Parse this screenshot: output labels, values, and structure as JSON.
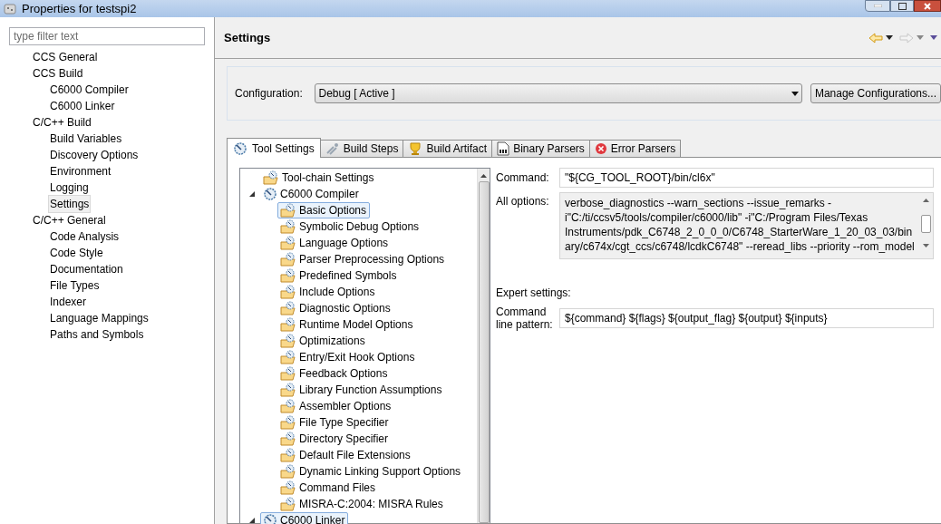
{
  "window": {
    "title": "Properties for testspi2"
  },
  "filter": {
    "placeholder": "type filter text"
  },
  "sidebar": {
    "items": [
      {
        "label": "CCS General",
        "selected": false
      },
      {
        "label": "CCS Build",
        "selected": false,
        "children": [
          {
            "label": "C6000 Compiler",
            "selected": false
          },
          {
            "label": "C6000 Linker",
            "selected": false
          }
        ]
      },
      {
        "label": "C/C++ Build",
        "selected": false,
        "children": [
          {
            "label": "Build Variables",
            "selected": false
          },
          {
            "label": "Discovery Options",
            "selected": false
          },
          {
            "label": "Environment",
            "selected": false
          },
          {
            "label": "Logging",
            "selected": false
          },
          {
            "label": "Settings",
            "selected": true
          }
        ]
      },
      {
        "label": "C/C++ General",
        "selected": false,
        "children": [
          {
            "label": "Code Analysis",
            "selected": false
          },
          {
            "label": "Code Style",
            "selected": false
          },
          {
            "label": "Documentation",
            "selected": false
          },
          {
            "label": "File Types",
            "selected": false
          },
          {
            "label": "Indexer",
            "selected": false
          },
          {
            "label": "Language Mappings",
            "selected": false
          },
          {
            "label": "Paths and Symbols",
            "selected": false
          }
        ]
      }
    ]
  },
  "page": {
    "title": "Settings"
  },
  "configuration": {
    "label": "Configuration:",
    "value": "Debug  [ Active ]",
    "button": "Manage Configurations..."
  },
  "tabs": [
    {
      "label": "Tool Settings",
      "kind": "gear",
      "selected": true
    },
    {
      "label": "Build Steps",
      "kind": "steps",
      "selected": false
    },
    {
      "label": "Build Artifact",
      "kind": "trophy",
      "selected": false
    },
    {
      "label": "Binary Parsers",
      "kind": "binary",
      "selected": false
    },
    {
      "label": "Error Parsers",
      "kind": "error",
      "selected": false
    }
  ],
  "tool_tree": [
    {
      "label": "Tool-chain Settings",
      "kind": "folder",
      "selected": false
    },
    {
      "label": "C6000 Compiler",
      "kind": "tool",
      "selected": false,
      "expanded": true,
      "children": [
        {
          "label": "Basic Options",
          "kind": "folder",
          "selected": true
        },
        {
          "label": "Symbolic Debug Options",
          "kind": "folder",
          "selected": false
        },
        {
          "label": "Language Options",
          "kind": "folder",
          "selected": false
        },
        {
          "label": "Parser Preprocessing Options",
          "kind": "folder",
          "selected": false
        },
        {
          "label": "Predefined Symbols",
          "kind": "folder",
          "selected": false
        },
        {
          "label": "Include Options",
          "kind": "folder",
          "selected": false
        },
        {
          "label": "Diagnostic Options",
          "kind": "folder",
          "selected": false
        },
        {
          "label": "Runtime Model Options",
          "kind": "folder",
          "selected": false
        },
        {
          "label": "Optimizations",
          "kind": "folder",
          "selected": false
        },
        {
          "label": "Entry/Exit Hook Options",
          "kind": "folder",
          "selected": false
        },
        {
          "label": "Feedback Options",
          "kind": "folder",
          "selected": false
        },
        {
          "label": "Library Function Assumptions",
          "kind": "folder",
          "selected": false
        },
        {
          "label": "Assembler Options",
          "kind": "folder",
          "selected": false
        },
        {
          "label": "File Type Specifier",
          "kind": "folder",
          "selected": false
        },
        {
          "label": "Directory Specifier",
          "kind": "folder",
          "selected": false
        },
        {
          "label": "Default File Extensions",
          "kind": "folder",
          "selected": false
        },
        {
          "label": "Dynamic Linking Support Options",
          "kind": "folder",
          "selected": false
        },
        {
          "label": "Command Files",
          "kind": "folder",
          "selected": false
        },
        {
          "label": "MISRA-C:2004: MISRA Rules",
          "kind": "folder",
          "selected": false
        }
      ]
    },
    {
      "label": "C6000 Linker",
      "kind": "tool",
      "selected": true,
      "expanded": true
    }
  ],
  "command": {
    "label": "Command:",
    "value": "\"${CG_TOOL_ROOT}/bin/cl6x\""
  },
  "all_options": {
    "label": "All options:",
    "value": "verbose_diagnostics --warn_sections --issue_remarks -i\"C:/ti/ccsv5/tools/compiler/c6000/lib\" -i\"C:/Program Files/Texas Instruments/pdk_C6748_2_0_0_0/C6748_StarterWare_1_20_03_03/binary/c674x/cgt_ccs/c6748/lcdkC6748\" --reread_libs --priority --rom_model"
  },
  "expert": {
    "heading": "Expert settings:",
    "label": "Command line pattern:",
    "value": "${command} ${flags} ${output_flag} ${output} ${inputs}"
  }
}
